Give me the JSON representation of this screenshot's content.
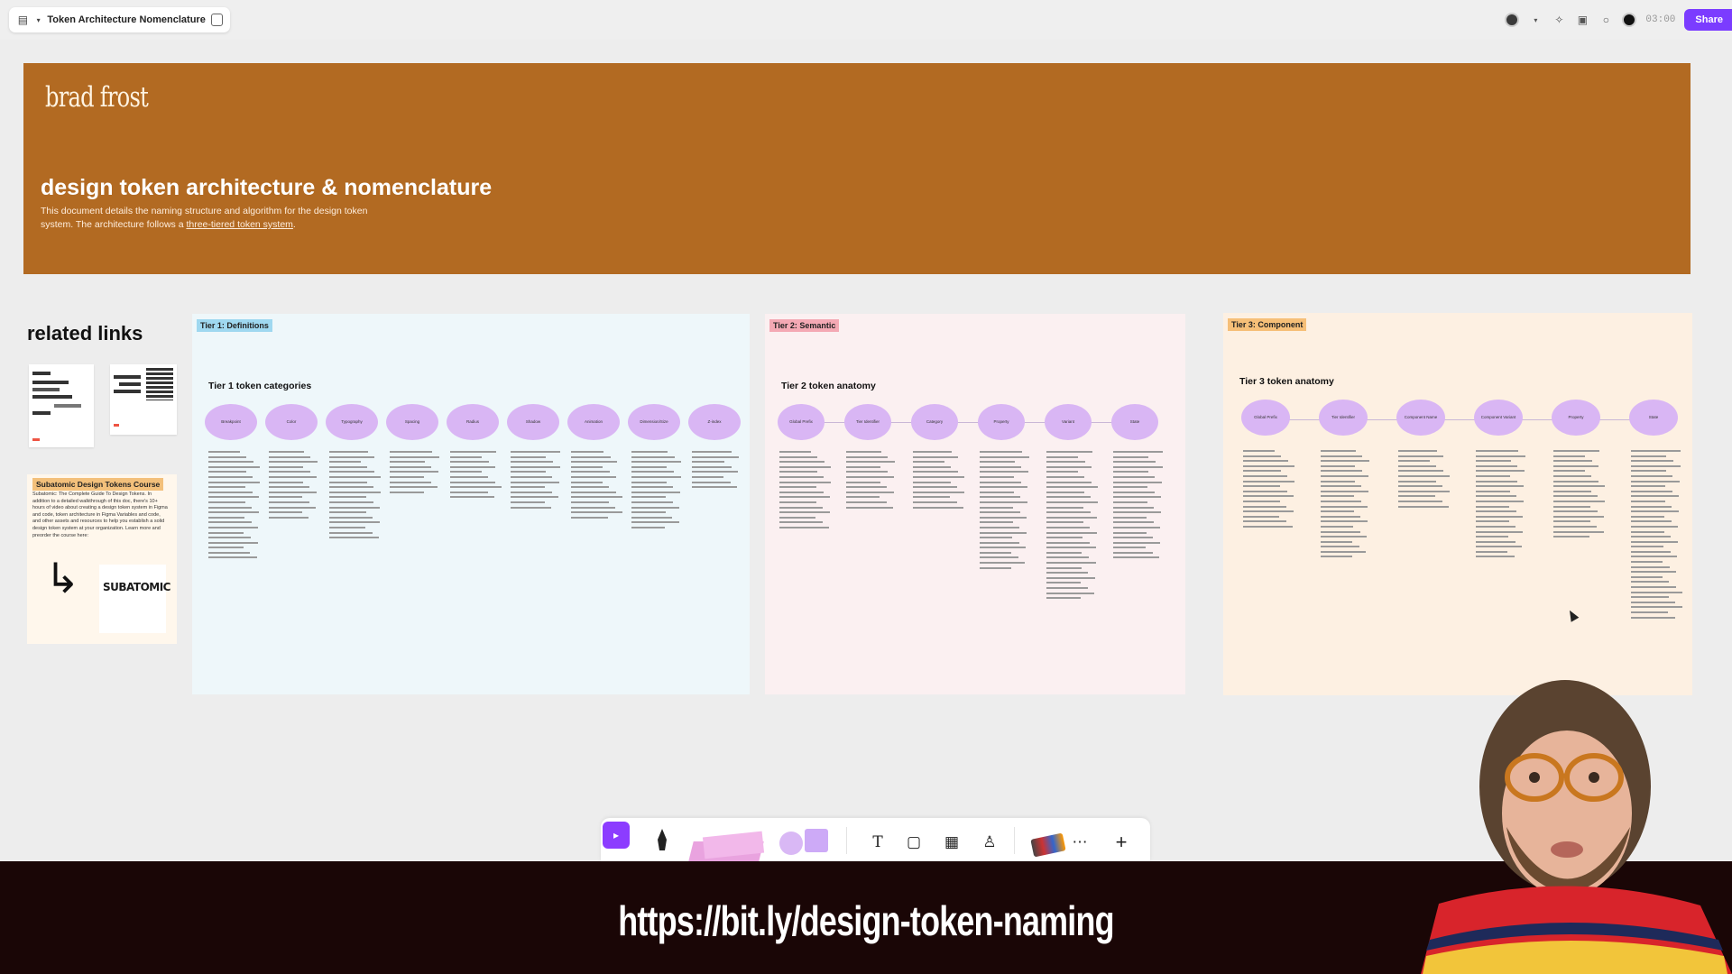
{
  "file": {
    "name": "Token Architecture Nomenclature"
  },
  "topbar": {
    "timer": "03:00",
    "share_label": "Share"
  },
  "hero": {
    "brand": "brad frost",
    "title": "design token architecture & nomenclature",
    "desc_pre": "This document details the naming structure and algorithm for the design token system. The architecture follows a ",
    "desc_link": "three-tiered token system",
    "desc_post": "."
  },
  "related": {
    "title": "related links",
    "course_tag": "Subatomic Design Tokens Course",
    "course_text": "Subatomic: The Complete Guide To Design Tokens. In addition to a detailed walkthrough of this doc, there's 10+ hours of video about creating a design token system in Figma and code, token architecture in Figma Variables and code, and other assets and resources to help you establish a solid design token system at your organization. Learn more and preorder the course here:",
    "course_brand": "SUBATOMIC"
  },
  "tier1": {
    "tag": "Tier 1: Definitions",
    "title": "Tier 1 token categories",
    "pills": [
      "Breakpoint",
      "Color",
      "Typography",
      "Spacing",
      "Radius",
      "Shadow",
      "Animation",
      "Dimension/Size",
      "Z-index"
    ]
  },
  "tier2": {
    "tag": "Tier 2: Semantic",
    "title": "Tier 2 token anatomy",
    "pills": [
      "Global Prefix",
      "Tier Identifier",
      "Category",
      "Property",
      "Variant",
      "State"
    ]
  },
  "tier3": {
    "tag": "Tier 3: Component",
    "title": "Tier 3 token anatomy",
    "pills": [
      "Global Prefix",
      "Tier Identifier",
      "Component Name",
      "Component Variant",
      "Property",
      "State"
    ]
  },
  "toolbar": {
    "text_tool": "T",
    "more_tool": "⋯",
    "plus": "+"
  },
  "caption": {
    "url": "https://bit.ly/design-token-naming"
  },
  "colors": {
    "hero": "#b26a22",
    "tier1": "#9fd8f0",
    "tier2": "#f4a9b4",
    "tier3": "#f6bf78",
    "accent": "#8c3cff"
  }
}
